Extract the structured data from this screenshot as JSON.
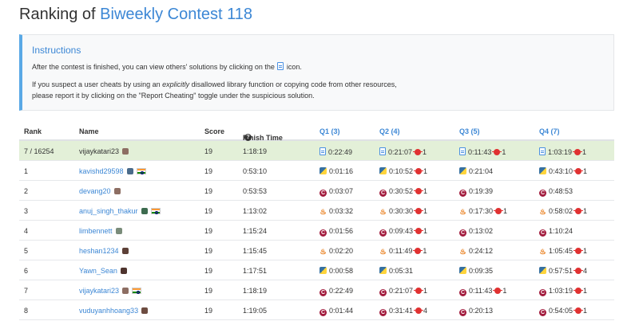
{
  "page": {
    "title_prefix": "Ranking of ",
    "contest_name": "Biweekly Contest 118"
  },
  "instructions": {
    "heading": "Instructions",
    "line1_before": "After the contest is finished, you can view others' solutions by clicking on the",
    "line1_after": "icon.",
    "line2_before": "If you suspect a user cheats by using an ",
    "line2_em": "explicitly",
    "line2_after": " disallowed library function or copying code from other resources,",
    "line3": "please report it by clicking on the \"Report Cheating\" toggle under the suspicious solution."
  },
  "table": {
    "headers": {
      "rank": "Rank",
      "name": "Name",
      "score": "Score",
      "finish": "Finish Time",
      "q1": "Q1 (3)",
      "q2": "Q2 (4)",
      "q3": "Q3 (5)",
      "q4": "Q4 (7)"
    },
    "rows": [
      {
        "rank": "7 / 16254",
        "name": "vijaykatari23",
        "link": false,
        "avatar_color": "#8d6e63",
        "flag": false,
        "score": "19",
        "finish": "1:18:19",
        "q1": {
          "time": "0:22:49",
          "lang": "file",
          "bugs": ""
        },
        "q2": {
          "time": "0:21:07",
          "lang": "file",
          "bugs": "1"
        },
        "q3": {
          "time": "0:11:43",
          "lang": "file",
          "bugs": "1"
        },
        "q4": {
          "time": "1:03:19",
          "lang": "file",
          "bugs": "1"
        },
        "highlight": true
      },
      {
        "rank": "1",
        "name": "kavishd29598",
        "link": true,
        "avatar_color": "#4a6b8a",
        "flag": true,
        "score": "19",
        "finish": "0:53:10",
        "q1": {
          "time": "0:01:16",
          "lang": "python",
          "bugs": ""
        },
        "q2": {
          "time": "0:10:52",
          "lang": "python",
          "bugs": "1"
        },
        "q3": {
          "time": "0:21:04",
          "lang": "python",
          "bugs": ""
        },
        "q4": {
          "time": "0:43:10",
          "lang": "python",
          "bugs": "1"
        },
        "highlight": false
      },
      {
        "rank": "2",
        "name": "devang20",
        "link": true,
        "avatar_color": "#8d6e63",
        "flag": false,
        "score": "19",
        "finish": "0:53:53",
        "q1": {
          "time": "0:03:07",
          "lang": "cpp",
          "bugs": ""
        },
        "q2": {
          "time": "0:30:52",
          "lang": "cpp",
          "bugs": "1"
        },
        "q3": {
          "time": "0:19:39",
          "lang": "cpp",
          "bugs": ""
        },
        "q4": {
          "time": "0:48:53",
          "lang": "cpp",
          "bugs": ""
        },
        "highlight": false
      },
      {
        "rank": "3",
        "name": "anuj_singh_thakur",
        "link": true,
        "avatar_color": "#3d6b4f",
        "flag": true,
        "score": "19",
        "finish": "1:13:02",
        "q1": {
          "time": "0:03:32",
          "lang": "java",
          "bugs": ""
        },
        "q2": {
          "time": "0:30:30",
          "lang": "java",
          "bugs": "1"
        },
        "q3": {
          "time": "0:17:30",
          "lang": "java",
          "bugs": "1"
        },
        "q4": {
          "time": "0:58:02",
          "lang": "java",
          "bugs": "1"
        },
        "highlight": false
      },
      {
        "rank": "4",
        "name": "limbennett",
        "link": true,
        "avatar_color": "#7a8c7a",
        "flag": false,
        "score": "19",
        "finish": "1:15:24",
        "q1": {
          "time": "0:01:56",
          "lang": "cpp",
          "bugs": ""
        },
        "q2": {
          "time": "0:09:43",
          "lang": "cpp",
          "bugs": "1"
        },
        "q3": {
          "time": "0:13:02",
          "lang": "cpp",
          "bugs": ""
        },
        "q4": {
          "time": "1:10:24",
          "lang": "cpp",
          "bugs": ""
        },
        "highlight": false
      },
      {
        "rank": "5",
        "name": "heshan1234",
        "link": true,
        "avatar_color": "#5d4037",
        "flag": false,
        "score": "19",
        "finish": "1:15:45",
        "q1": {
          "time": "0:02:20",
          "lang": "java",
          "bugs": ""
        },
        "q2": {
          "time": "0:11:49",
          "lang": "java",
          "bugs": "1"
        },
        "q3": {
          "time": "0:24:12",
          "lang": "java",
          "bugs": ""
        },
        "q4": {
          "time": "1:05:45",
          "lang": "java",
          "bugs": "1"
        },
        "highlight": false
      },
      {
        "rank": "6",
        "name": "Yawn_Sean",
        "link": true,
        "avatar_color": "#4e342e",
        "flag": false,
        "score": "19",
        "finish": "1:17:51",
        "q1": {
          "time": "0:00:58",
          "lang": "python",
          "bugs": ""
        },
        "q2": {
          "time": "0:05:31",
          "lang": "python",
          "bugs": ""
        },
        "q3": {
          "time": "0:09:35",
          "lang": "python",
          "bugs": ""
        },
        "q4": {
          "time": "0:57:51",
          "lang": "python",
          "bugs": "4"
        },
        "highlight": false
      },
      {
        "rank": "7",
        "name": "vijaykatari23",
        "link": true,
        "avatar_color": "#8d6e63",
        "flag": true,
        "score": "19",
        "finish": "1:18:19",
        "q1": {
          "time": "0:22:49",
          "lang": "cpp",
          "bugs": ""
        },
        "q2": {
          "time": "0:21:07",
          "lang": "cpp",
          "bugs": "1"
        },
        "q3": {
          "time": "0:11:43",
          "lang": "cpp",
          "bugs": "1"
        },
        "q4": {
          "time": "1:03:19",
          "lang": "cpp",
          "bugs": "1"
        },
        "highlight": false
      },
      {
        "rank": "8",
        "name": "vuduyanhhoang33",
        "link": true,
        "avatar_color": "#6d4c41",
        "flag": false,
        "score": "19",
        "finish": "1:19:05",
        "q1": {
          "time": "0:01:44",
          "lang": "cpp",
          "bugs": ""
        },
        "q2": {
          "time": "0:31:41",
          "lang": "cpp",
          "bugs": "4"
        },
        "q3": {
          "time": "0:20:13",
          "lang": "cpp",
          "bugs": ""
        },
        "q4": {
          "time": "0:54:05",
          "lang": "cpp",
          "bugs": "1"
        },
        "highlight": false
      }
    ]
  }
}
